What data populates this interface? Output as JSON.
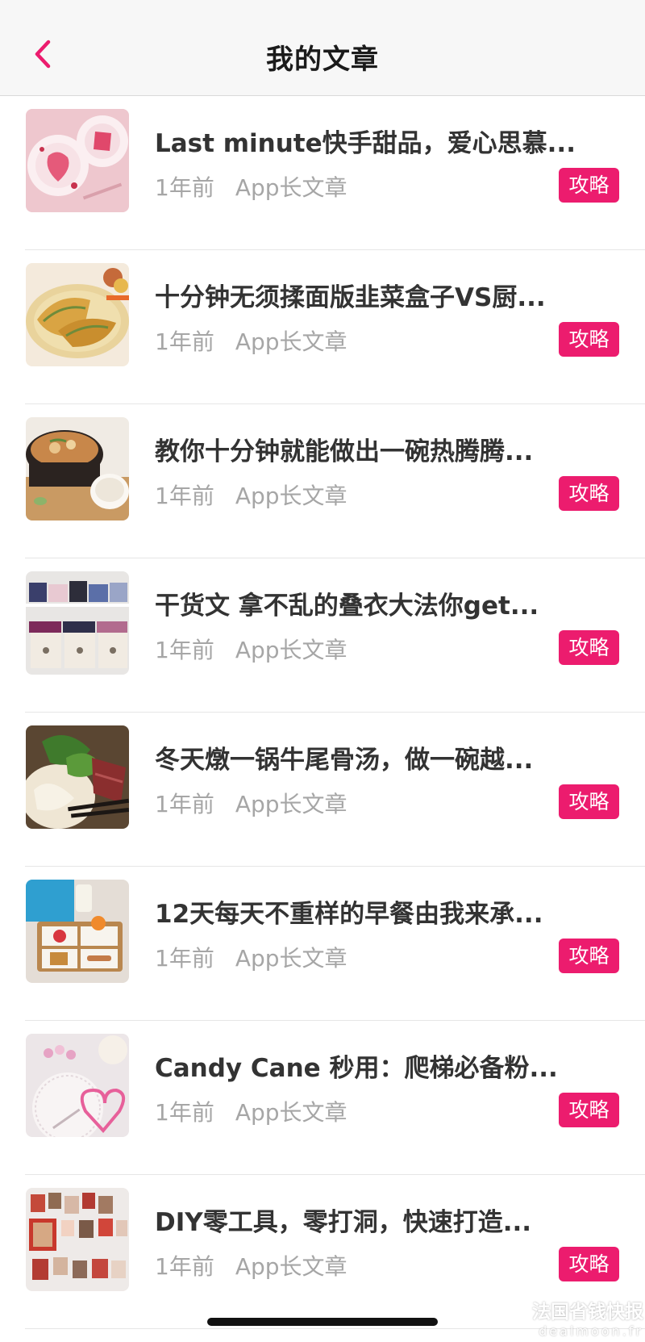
{
  "header": {
    "title": "我的文章",
    "back_icon": "chevron-left-icon",
    "accent": "#ec1c6e"
  },
  "articles": [
    {
      "title": "Last minute快手甜品，爱心思慕...",
      "time": "1年前",
      "source": "App长文章",
      "tag": "攻略"
    },
    {
      "title": "十分钟无须揉面版韭菜盒子VS厨...",
      "time": "1年前",
      "source": "App长文章",
      "tag": "攻略"
    },
    {
      "title": "教你十分钟就能做出一碗热腾腾...",
      "time": "1年前",
      "source": "App长文章",
      "tag": "攻略"
    },
    {
      "title": "干货文 拿不乱的叠衣大法你get...",
      "time": "1年前",
      "source": "App长文章",
      "tag": "攻略"
    },
    {
      "title": "冬天燉一锅牛尾骨汤，做一碗越...",
      "time": "1年前",
      "source": "App长文章",
      "tag": "攻略"
    },
    {
      "title": "12天每天不重样的早餐由我来承...",
      "time": "1年前",
      "source": "App长文章",
      "tag": "攻略"
    },
    {
      "title": "Candy Cane 秒用：爬梯必备粉...",
      "time": "1年前",
      "source": "App长文章",
      "tag": "攻略"
    },
    {
      "title": "DIY零工具，零打洞，快速打造...",
      "time": "1年前",
      "source": "App长文章",
      "tag": "攻略"
    }
  ],
  "watermark": {
    "line1": "法国省钱快报",
    "line2": "dealmoon.fr"
  }
}
